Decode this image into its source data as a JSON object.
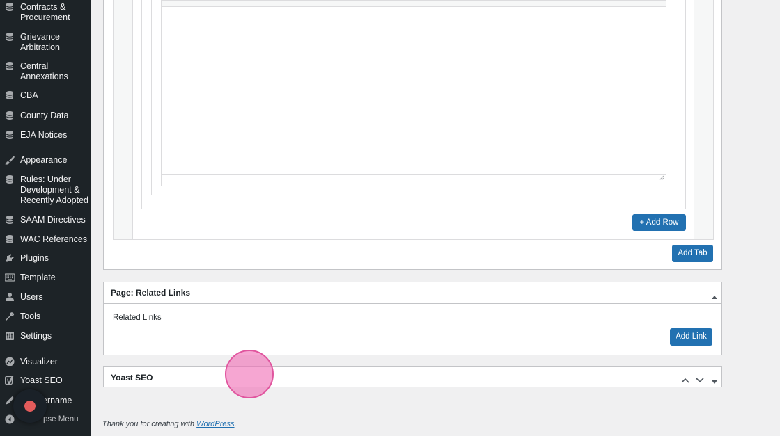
{
  "sidebar": {
    "items": [
      {
        "label": "Contracts & Procurement",
        "icon": "database-icon"
      },
      {
        "label": "Grievance Arbitration",
        "icon": "database-icon"
      },
      {
        "label": "Central Annexations",
        "icon": "database-icon"
      },
      {
        "label": "CBA",
        "icon": "database-icon"
      },
      {
        "label": "County Data",
        "icon": "database-icon"
      },
      {
        "label": "EJA Notices",
        "icon": "database-icon"
      },
      {
        "label": "Appearance",
        "icon": "paintbrush-icon"
      },
      {
        "label": "Rules: Under Development & Recently Adopted",
        "icon": "database-icon"
      },
      {
        "label": "SAAM Directives",
        "icon": "database-icon"
      },
      {
        "label": "WAC References",
        "icon": "database-icon"
      },
      {
        "label": "Plugins",
        "icon": "plugin-icon"
      },
      {
        "label": "Template",
        "icon": "keyboard-icon"
      },
      {
        "label": "Users",
        "icon": "user-icon"
      },
      {
        "label": "Tools",
        "icon": "wrench-icon"
      },
      {
        "label": "Settings",
        "icon": "settings-icon"
      },
      {
        "label": "Visualizer",
        "icon": "chart-icon"
      },
      {
        "label": "Yoast SEO",
        "icon": "yoast-icon"
      },
      {
        "label": "ername",
        "icon": "pencil-icon"
      },
      {
        "label": "pse Menu",
        "icon": "collapse-icon"
      }
    ]
  },
  "editor": {
    "add_row_label": "+ Add Row",
    "add_tab_label": "Add Tab"
  },
  "related_links": {
    "title": "Page: Related Links",
    "field_label": "Related Links",
    "add_link_label": "Add Link"
  },
  "yoast": {
    "title": "Yoast SEO"
  },
  "footer": {
    "prefix": "Thank you for creating with ",
    "link": "WordPress",
    "suffix": "."
  },
  "colors": {
    "sidebar_bg": "#1d2327",
    "button_blue": "#2271b1",
    "cursor_pink": "#f06bb4",
    "record_red": "#e35b5b"
  }
}
